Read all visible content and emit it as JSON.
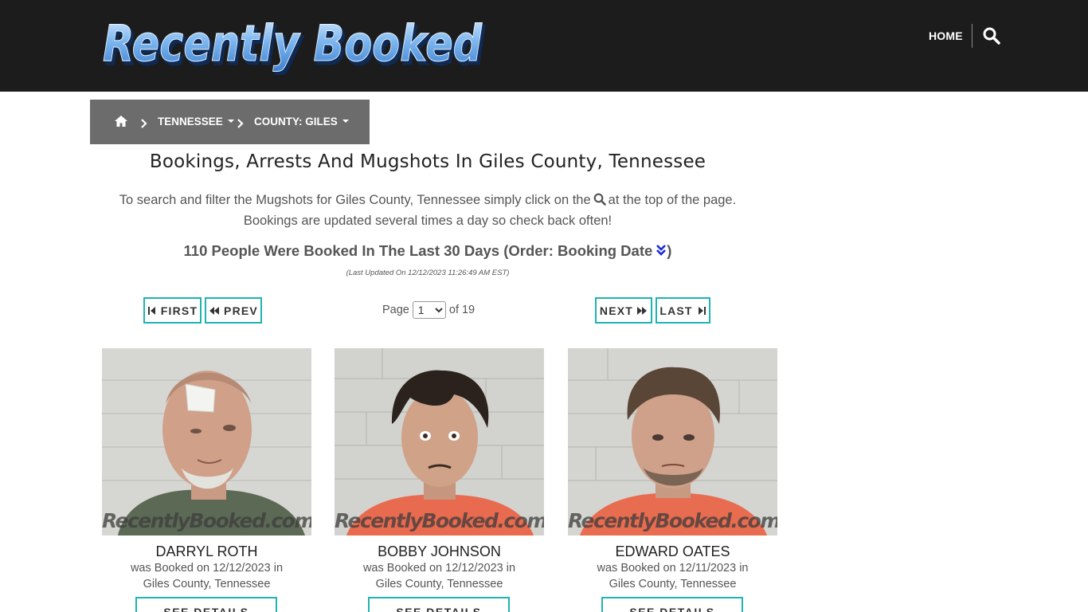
{
  "header": {
    "logo_text": "Recently Booked",
    "nav_home": "HOME",
    "icons": {
      "search": "search-icon"
    }
  },
  "breadcrumb": {
    "home_icon": "home-icon",
    "state": "TENNESSEE",
    "county": "COUNTY: GILES"
  },
  "main": {
    "title": "Bookings, Arrests And Mugshots In Giles County, Tennessee",
    "intro_before": "To search and filter the Mugshots for Giles County, Tennessee simply click on the",
    "intro_after": "at the top of the page.",
    "intro_line2": "Bookings are updated several times a day so check back often!",
    "count_text": "110 People Were Booked In The Last 30 Days (Order: Booking Date",
    "count_close": ")",
    "last_updated": "(Last Updated On 12/12/2023 11:26:49 AM EST)"
  },
  "pagination": {
    "first": "FIRST",
    "prev": "PREV",
    "next": "NEXT",
    "last": "LAST",
    "page_label": "Page",
    "current_page": "1",
    "of_label": "of 19"
  },
  "cards": [
    {
      "name": "DARRYL ROTH",
      "line1": "was Booked on 12/12/2023 in",
      "line2": "Giles County, Tennessee",
      "watermark": "RecentlyBooked.com",
      "button": "SEE DETAILS"
    },
    {
      "name": "BOBBY JOHNSON",
      "line1": "was Booked on 12/12/2023 in",
      "line2": "Giles County, Tennessee",
      "watermark": "RecentlyBooked.com",
      "button": "SEE DETAILS"
    },
    {
      "name": "EDWARD OATES",
      "line1": "was Booked on 12/11/2023 in",
      "line2": "Giles County, Tennessee",
      "watermark": "RecentlyBooked.com",
      "button": "SEE DETAILS"
    }
  ],
  "colors": {
    "header_bg": "#1c1c1c",
    "breadcrumb_bg": "#6c6c6c",
    "button_border": "#1fb3b1",
    "logo_blue": "#5aa0e6"
  }
}
